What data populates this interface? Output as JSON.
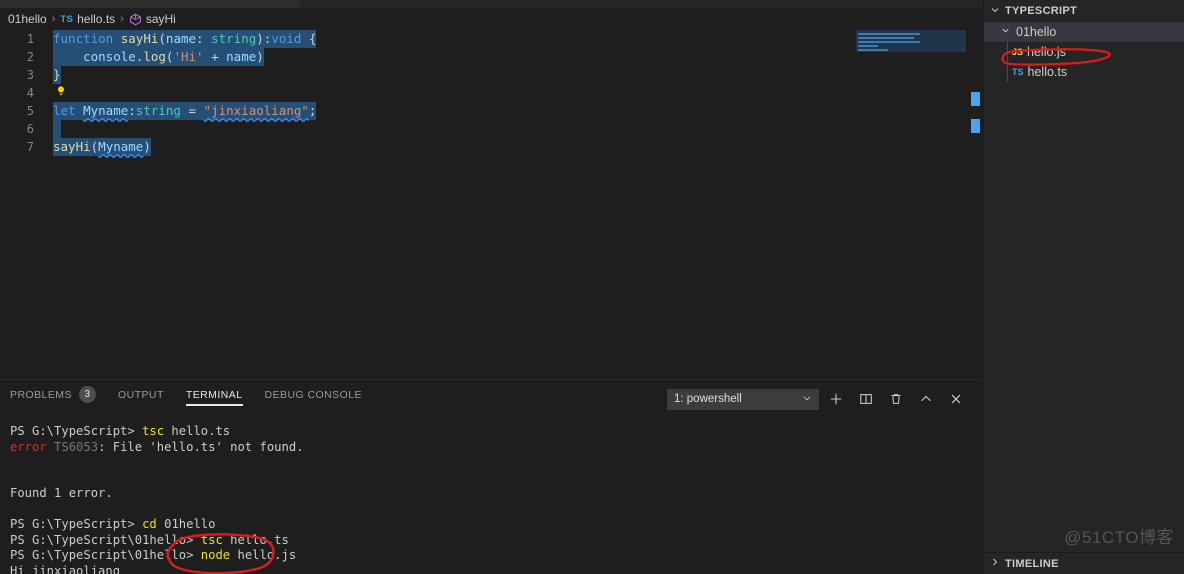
{
  "breadcrumb": {
    "folder": "01hello",
    "file": "hello.ts",
    "file_badge": "TS",
    "symbol": "sayHi",
    "separator": "›"
  },
  "editor": {
    "lines": [
      {
        "num": "1",
        "tokens": [
          {
            "t": "function",
            "c": "kw"
          },
          {
            "t": "·",
            "c": "ws"
          },
          {
            "t": "sayHi",
            "c": "fn"
          },
          {
            "t": "(",
            "c": "punc"
          },
          {
            "t": "name",
            "c": "param"
          },
          {
            "t": ":",
            "c": "punc"
          },
          {
            "t": "·",
            "c": "ws"
          },
          {
            "t": "string",
            "c": "type"
          },
          {
            "t": ")",
            "c": "punc"
          },
          {
            "t": ":",
            "c": "punc"
          },
          {
            "t": "void",
            "c": "kw"
          },
          {
            "t": "·",
            "c": "ws"
          },
          {
            "t": "{",
            "c": "punc"
          }
        ]
      },
      {
        "num": "2",
        "tokens": [
          {
            "t": "····",
            "c": "ws"
          },
          {
            "t": "console",
            "c": "param"
          },
          {
            "t": ".",
            "c": "punc"
          },
          {
            "t": "log",
            "c": "fn"
          },
          {
            "t": "(",
            "c": "punc"
          },
          {
            "t": "'Hi'",
            "c": "str"
          },
          {
            "t": "·",
            "c": "ws"
          },
          {
            "t": "+",
            "c": "plain"
          },
          {
            "t": "·",
            "c": "ws"
          },
          {
            "t": "name",
            "c": "param"
          },
          {
            "t": ")",
            "c": "punc"
          }
        ]
      },
      {
        "num": "3",
        "tokens": [
          {
            "t": "}",
            "c": "punc"
          }
        ]
      },
      {
        "num": "4",
        "tokens": [],
        "bulb": true
      },
      {
        "num": "5",
        "tokens": [
          {
            "t": "let",
            "c": "kw"
          },
          {
            "t": "·",
            "c": "ws"
          },
          {
            "t": "Myname",
            "c": "var sq-b"
          },
          {
            "t": ":",
            "c": "punc"
          },
          {
            "t": "string",
            "c": "type"
          },
          {
            "t": "·",
            "c": "ws"
          },
          {
            "t": "=",
            "c": "plain"
          },
          {
            "t": "·",
            "c": "ws"
          },
          {
            "t": "\"jinxiaoliang\"",
            "c": "str sq-b"
          },
          {
            "t": ";",
            "c": "punc"
          }
        ]
      },
      {
        "num": "6",
        "tokens": []
      },
      {
        "num": "7",
        "tokens": [
          {
            "t": "sayHi",
            "c": "fn"
          },
          {
            "t": "(",
            "c": "punc"
          },
          {
            "t": "Myname",
            "c": "var sq-b"
          },
          {
            "t": ")",
            "c": "punc"
          }
        ]
      }
    ],
    "bulb_icon": "lightbulb-quickfix-icon"
  },
  "panel": {
    "tabs": [
      {
        "label": "PROBLEMS",
        "badge": "3",
        "active": false
      },
      {
        "label": "OUTPUT",
        "badge": "",
        "active": false
      },
      {
        "label": "TERMINAL",
        "badge": "",
        "active": true
      },
      {
        "label": "DEBUG CONSOLE",
        "badge": "",
        "active": false
      }
    ],
    "terminal_select": "1: powershell",
    "actions": [
      {
        "name": "new-terminal-button",
        "glyph": "+"
      },
      {
        "name": "split-terminal-button",
        "glyph": "◫"
      },
      {
        "name": "kill-terminal-button",
        "glyph": "🗑"
      },
      {
        "name": "maximize-panel-button",
        "glyph": "⌃"
      },
      {
        "name": "close-panel-button",
        "glyph": "✕"
      }
    ],
    "terminal_lines": [
      {
        "segs": [
          {
            "t": "PS G:\\TypeScript> ",
            "c": ""
          },
          {
            "t": "tsc",
            "c": "t-yellow"
          },
          {
            "t": " hello.ts",
            "c": ""
          }
        ]
      },
      {
        "segs": [
          {
            "t": "error",
            "c": "t-red"
          },
          {
            "t": " TS6053",
            "c": "t-gray"
          },
          {
            "t": ": File 'hello.ts' not found.",
            "c": ""
          }
        ]
      },
      {
        "segs": [
          {
            "t": "",
            "c": ""
          }
        ]
      },
      {
        "segs": [
          {
            "t": "",
            "c": ""
          }
        ]
      },
      {
        "segs": [
          {
            "t": "Found 1 error.",
            "c": ""
          }
        ]
      },
      {
        "segs": [
          {
            "t": "",
            "c": ""
          }
        ]
      },
      {
        "segs": [
          {
            "t": "PS G:\\TypeScript> ",
            "c": ""
          },
          {
            "t": "cd",
            "c": "t-yellow"
          },
          {
            "t": " 01hello",
            "c": ""
          }
        ]
      },
      {
        "segs": [
          {
            "t": "PS G:\\TypeScript\\01hello> ",
            "c": ""
          },
          {
            "t": "tsc",
            "c": "t-yellow"
          },
          {
            "t": " hello.ts",
            "c": ""
          }
        ]
      },
      {
        "segs": [
          {
            "t": "PS G:\\TypeScript\\01hello> ",
            "c": ""
          },
          {
            "t": "node",
            "c": "t-yellow"
          },
          {
            "t": " hello.js",
            "c": ""
          }
        ]
      },
      {
        "segs": [
          {
            "t": "Hi jinxiaoliang",
            "c": ""
          }
        ]
      }
    ]
  },
  "sidebar": {
    "section_title": "TYPESCRIPT",
    "timeline_title": "TIMELINE",
    "tree": [
      {
        "label": "01hello",
        "kind": "folder",
        "indent": 1,
        "expanded": true,
        "selected": true
      },
      {
        "label": "hello.js",
        "kind": "js",
        "badge": "JS",
        "indent": 2,
        "selected": false
      },
      {
        "label": "hello.ts",
        "kind": "ts",
        "badge": "TS",
        "indent": 2,
        "selected": false
      }
    ],
    "watermark": "@51CTO博客"
  },
  "colors": {
    "editor_bg": "#1e1e1e",
    "sidebar_bg": "#252526",
    "selection": "#264f78",
    "accent_blue": "#4a9fd6",
    "annotation_red": "#e01b1b",
    "error_red": "#cd3131",
    "terminal_yellow": "#e5e510"
  }
}
